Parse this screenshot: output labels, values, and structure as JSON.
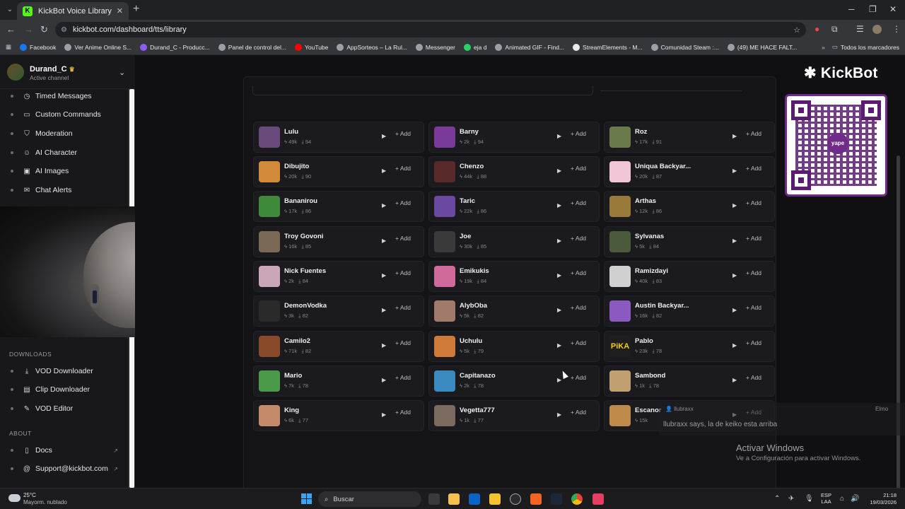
{
  "browser": {
    "tab_title": "KickBot Voice Library",
    "url": "kickbot.com/dashboard/tts/library",
    "bookmarks": [
      {
        "label": "Facebook",
        "color": "#1877f2"
      },
      {
        "label": "Ver Anime Online S...",
        "color": "#9aa0a6"
      },
      {
        "label": "Durand_C - Producc...",
        "color": "#8b5cf6"
      },
      {
        "label": "Panel de control del...",
        "color": "#9aa0a6"
      },
      {
        "label": "YouTube",
        "color": "#ff0000"
      },
      {
        "label": "AppSorteos – La Rul...",
        "color": "#9aa0a6"
      },
      {
        "label": "Messenger",
        "color": "#9aa0a6"
      },
      {
        "label": "eja d",
        "color": "#25d366"
      },
      {
        "label": "Animated GIF - Find...",
        "color": "#9aa0a6"
      },
      {
        "label": "StreamElements - M...",
        "color": "#e8eaed"
      },
      {
        "label": "Comunidad Steam :...",
        "color": "#9aa0a6"
      },
      {
        "label": "(49) ME HACE FALT...",
        "color": "#9aa0a6"
      }
    ],
    "all_bookmarks": "Todos los marcadores"
  },
  "sidebar": {
    "channel_name": "Durand_C",
    "channel_sub": "Active channel",
    "items_top": [
      {
        "label": "Timed Messages",
        "icon": "clock-icon"
      },
      {
        "label": "Custom Commands",
        "icon": "terminal-icon"
      },
      {
        "label": "Moderation",
        "icon": "shield-icon"
      },
      {
        "label": "AI Character",
        "icon": "ai-character-icon"
      },
      {
        "label": "AI Images",
        "icon": "ai-images-icon"
      },
      {
        "label": "Chat Alerts",
        "icon": "chat-alerts-icon"
      }
    ],
    "downloads_heading": "DOWNLOADS",
    "downloads": [
      {
        "label": "VOD Downloader",
        "icon": "download-icon"
      },
      {
        "label": "Clip Downloader",
        "icon": "clip-icon"
      },
      {
        "label": "VOD Editor",
        "icon": "edit-icon"
      }
    ],
    "about_heading": "ABOUT",
    "about": [
      {
        "label": "Docs",
        "icon": "book-icon"
      },
      {
        "label": "Support@kickbot.com",
        "icon": "at-icon"
      }
    ]
  },
  "brand": {
    "logo_text": "KickBot",
    "qr_label": "yape"
  },
  "voices": {
    "add_label": "+ Add",
    "col1": [
      {
        "name": "Lulu",
        "uses": "49k",
        "downloads": "94",
        "color": "#6a4a7a"
      },
      {
        "name": "Dibujito",
        "uses": "20k",
        "downloads": "90",
        "color": "#d08a3a"
      },
      {
        "name": "Bananirou",
        "uses": "17k",
        "downloads": "86",
        "color": "#3f8a3a"
      },
      {
        "name": "Troy Govoni",
        "uses": "16k",
        "downloads": "85",
        "color": "#7a6a55"
      },
      {
        "name": "Nick Fuentes",
        "uses": "2k",
        "downloads": "84",
        "color": "#c9a6b8"
      },
      {
        "name": "DemonVodka",
        "uses": "3k",
        "downloads": "82",
        "color": "#2a2a2a"
      },
      {
        "name": "Camilo2",
        "uses": "71k",
        "downloads": "82",
        "color": "#8a4a2a"
      },
      {
        "name": "Mario",
        "uses": "7k",
        "downloads": "78",
        "color": "#4a9a4a"
      },
      {
        "name": "King",
        "uses": "6k",
        "downloads": "77",
        "color": "#c48a6a"
      }
    ],
    "col2": [
      {
        "name": "Barny",
        "uses": "2k",
        "downloads": "94",
        "color": "#7a3a9a"
      },
      {
        "name": "Chenzo",
        "uses": "44k",
        "downloads": "88",
        "color": "#5a2a2a"
      },
      {
        "name": "Taric",
        "uses": "22k",
        "downloads": "86",
        "color": "#6a4aa0"
      },
      {
        "name": "Joe",
        "uses": "30k",
        "downloads": "85",
        "color": "#3a3a3a"
      },
      {
        "name": "Emikukis",
        "uses": "19k",
        "downloads": "84",
        "color": "#d06a9a"
      },
      {
        "name": "AlybOba",
        "uses": "5k",
        "downloads": "82",
        "color": "#a07a6a"
      },
      {
        "name": "Uchulu",
        "uses": "5k",
        "downloads": "79",
        "color": "#d07a3a"
      },
      {
        "name": "Capitanazo",
        "uses": "2k",
        "downloads": "78",
        "color": "#3a8ac0"
      },
      {
        "name": "Vegetta777",
        "uses": "1k",
        "downloads": "77",
        "color": "#7a6a60"
      }
    ],
    "col3": [
      {
        "name": "Roz",
        "uses": "17k",
        "downloads": "91",
        "color": "#6a7a4a"
      },
      {
        "name": "Uniqua Backyar...",
        "uses": "20k",
        "downloads": "87",
        "color": "#f2c6d8"
      },
      {
        "name": "Arthas",
        "uses": "12k",
        "downloads": "86",
        "color": "#9a7a3a"
      },
      {
        "name": "Sylvanas",
        "uses": "5k",
        "downloads": "84",
        "color": "#4a5a3a"
      },
      {
        "name": "Ramizdayi",
        "uses": "40k",
        "downloads": "83",
        "color": "#d0d0d0"
      },
      {
        "name": "Austin Backyar...",
        "uses": "16k",
        "downloads": "82",
        "color": "#8a5ac0"
      },
      {
        "name": "Pablo",
        "uses": "23k",
        "downloads": "78",
        "color": "#1e1e1e"
      },
      {
        "name": "Sambond",
        "uses": "1k",
        "downloads": "78",
        "color": "#c0a070"
      },
      {
        "name": "Escanor",
        "uses": "15k",
        "downloads": "",
        "color": "#c08a4a"
      }
    ],
    "pablo_badge": "PiKA"
  },
  "chat_overlay": {
    "user": "llubraxx",
    "other_user": "Elmo",
    "message": "llubraxx says, la de keiko esta arriba"
  },
  "windows_activation": {
    "title": "Activar Windows",
    "subtitle": "Ve a Configuración para activar Windows."
  },
  "taskbar": {
    "temp": "25°C",
    "condition": "Mayorm. nublado",
    "search_placeholder": "Buscar",
    "lang_top": "ESP",
    "lang_bottom": "LAA",
    "time": "21:18",
    "date": "19/03/2026"
  }
}
